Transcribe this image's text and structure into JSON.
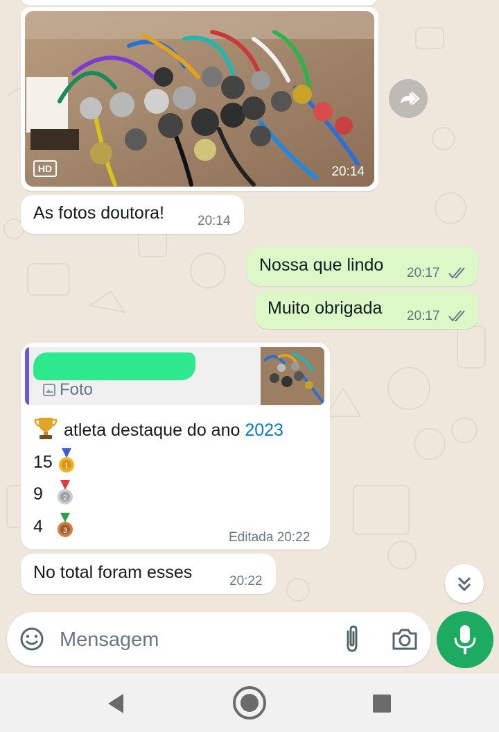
{
  "messages": {
    "photo_time": "20:14",
    "photo_badge": "HD",
    "m1": {
      "text": "As fotos doutora!",
      "time": "20:14"
    },
    "m2": {
      "text": "Nossa que lindo",
      "time": "20:17"
    },
    "m3": {
      "text": "Muito obrigada",
      "time": "20:17"
    },
    "quoted": {
      "label": "Foto"
    },
    "m4": {
      "line1_text": "atleta destaque do ano ",
      "line1_year": "2023",
      "gold_count": "15",
      "silver_count": "9",
      "bronze_count": "4",
      "edited_label": "Editada",
      "time": "20:22"
    },
    "m5": {
      "text": "No total foram esses",
      "time": "20:22"
    }
  },
  "composer": {
    "placeholder": "Mensagem"
  },
  "colors": {
    "outgoing": "#dcf8c6",
    "incoming": "#ffffff",
    "accent": "#1daa61",
    "link": "#027eb5"
  },
  "icons": [
    "forward-icon",
    "hd-icon",
    "image-icon",
    "trophy-icon",
    "gold-medal-icon",
    "silver-medal-icon",
    "bronze-medal-icon",
    "read-receipt-icon",
    "scroll-down-icon",
    "emoji-icon",
    "attach-icon",
    "camera-icon",
    "mic-icon",
    "nav-back-icon",
    "nav-home-icon",
    "nav-recents-icon"
  ]
}
